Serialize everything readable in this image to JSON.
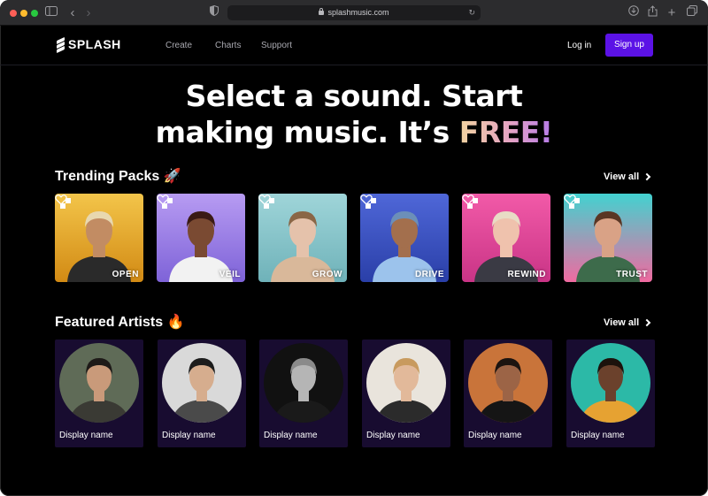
{
  "browser": {
    "url": "splashmusic.com"
  },
  "site": {
    "logo_text": "SPLASH",
    "nav": [
      "Create",
      "Charts",
      "Support"
    ],
    "login_label": "Log in",
    "signup_label": "Sign up",
    "accent_color": "#5b12e6"
  },
  "hero": {
    "line1": "Select a sound. Start",
    "line2_prefix": "making music. It’s ",
    "line2_highlight": "FREE!"
  },
  "trending": {
    "title": "Trending Packs 🚀",
    "view_all": "View all",
    "packs": [
      {
        "label": "OPEN",
        "bg_top": "#f3c54a",
        "bg_bottom": "#d28a14",
        "skin": "#c28c63",
        "shirt": "#2a2a2a",
        "hair": "#e8d8b0"
      },
      {
        "label": "VEIL",
        "bg_top": "#b79bf2",
        "bg_bottom": "#7e63d8",
        "skin": "#7a4a32",
        "shirt": "#f2f2f2",
        "hair": "#3a1a14"
      },
      {
        "label": "GROW",
        "bg_top": "#9fd5d9",
        "bg_bottom": "#6fb2b9",
        "skin": "#e5c2ab",
        "shirt": "#d9b89a",
        "hair": "#8a6646"
      },
      {
        "label": "DRIVE",
        "bg_top": "#4f67d8",
        "bg_bottom": "#2a3fa8",
        "skin": "#a36f4d",
        "shirt": "#9cc3ec",
        "hair": "#6c8fb8"
      },
      {
        "label": "REWIND",
        "bg_top": "#f25aa8",
        "bg_bottom": "#c93486",
        "skin": "#efc2ad",
        "shirt": "#3a3a44",
        "hair": "#e8dcc5"
      },
      {
        "label": "TRUST",
        "bg_top": "#42d2d0",
        "bg_bottom": "#f06aa0",
        "skin": "#d9a286",
        "shirt": "#3d6b4b",
        "hair": "#5a3624"
      }
    ]
  },
  "featured": {
    "title": "Featured Artists 🔥",
    "view_all": "View all",
    "artists": [
      {
        "name": "Display name",
        "bg": "#5f6b57",
        "skin": "#c99a7a",
        "hair": "#1e1a18",
        "shirt": "#3a3a34"
      },
      {
        "name": "Display name",
        "bg": "#d9d9d9",
        "skin": "#d6ad8e",
        "hair": "#1c1c1c",
        "shirt": "#4a4a4a"
      },
      {
        "name": "Display name",
        "bg": "#111111",
        "skin": "#b5b5b5",
        "hair": "#8a8a8a",
        "shirt": "#1a1a1a"
      },
      {
        "name": "Display name",
        "bg": "#e9e4dc",
        "skin": "#e2b99a",
        "hair": "#c89a5e",
        "shirt": "#2b2b2b"
      },
      {
        "name": "Display name",
        "bg": "#c9743a",
        "skin": "#9c6446",
        "hair": "#1c1410",
        "shirt": "#151515"
      },
      {
        "name": "Display name",
        "bg": "#2cb9a7",
        "skin": "#6b412c",
        "hair": "#1c120c",
        "shirt": "#e6a232"
      }
    ]
  }
}
